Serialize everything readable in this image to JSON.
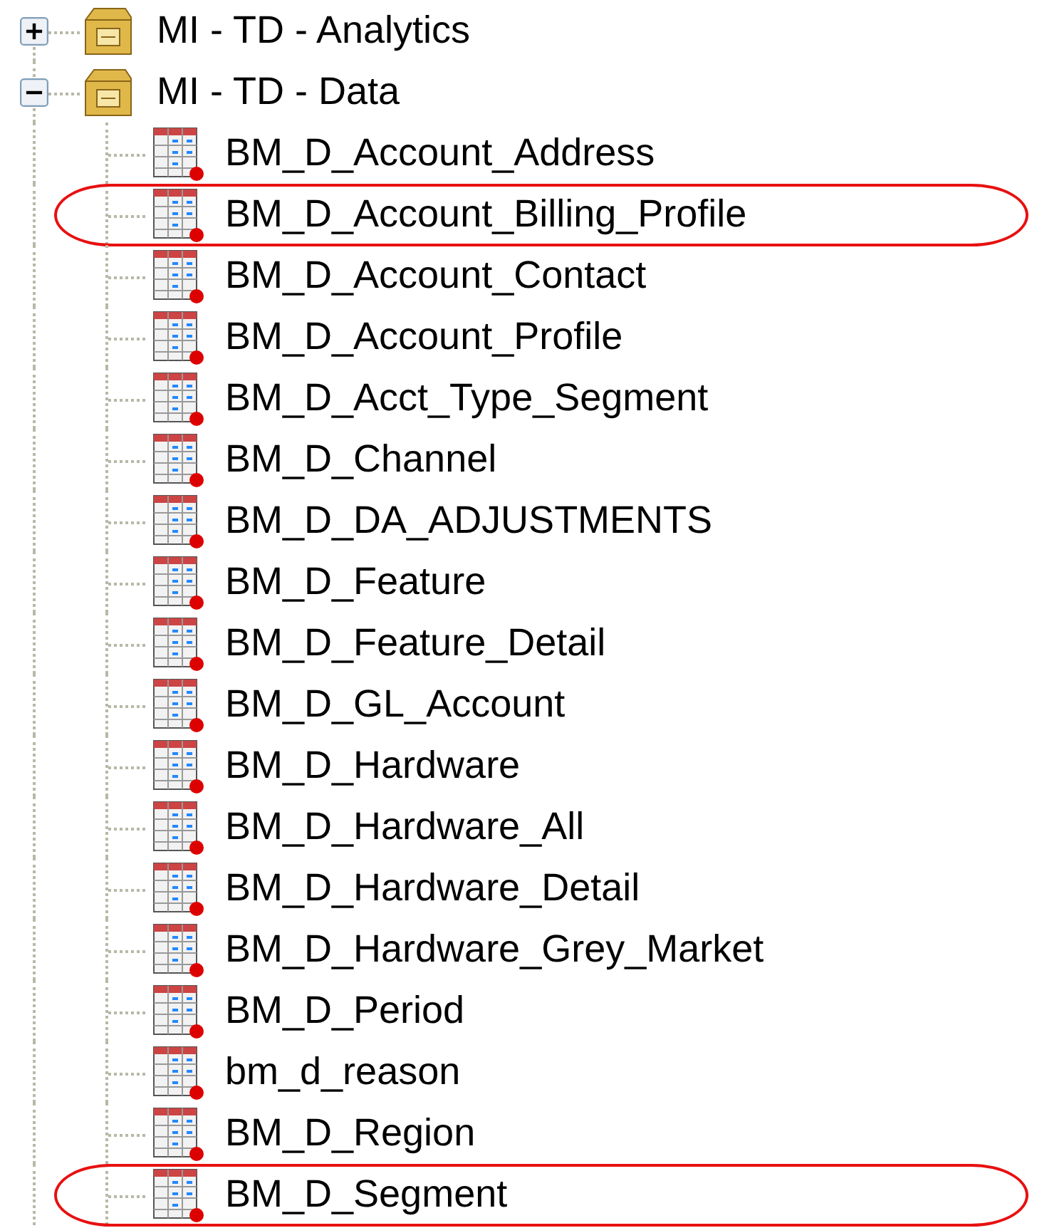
{
  "tree": [
    {
      "label": "MI - TD - Analytics",
      "expanded": false
    },
    {
      "label": "MI - TD - Data",
      "expanded": true,
      "children": [
        {
          "label": "BM_D_Account_Address",
          "circled": false
        },
        {
          "label": "BM_D_Account_Billing_Profile",
          "circled": true
        },
        {
          "label": "BM_D_Account_Contact",
          "circled": false
        },
        {
          "label": "BM_D_Account_Profile",
          "circled": false
        },
        {
          "label": "BM_D_Acct_Type_Segment",
          "circled": false
        },
        {
          "label": "BM_D_Channel",
          "circled": false
        },
        {
          "label": "BM_D_DA_ADJUSTMENTS",
          "circled": false
        },
        {
          "label": "BM_D_Feature",
          "circled": false
        },
        {
          "label": "BM_D_Feature_Detail",
          "circled": false
        },
        {
          "label": "BM_D_GL_Account",
          "circled": false
        },
        {
          "label": "BM_D_Hardware",
          "circled": false
        },
        {
          "label": "BM_D_Hardware_All",
          "circled": false
        },
        {
          "label": "BM_D_Hardware_Detail",
          "circled": false
        },
        {
          "label": "BM_D_Hardware_Grey_Market",
          "circled": false
        },
        {
          "label": "BM_D_Period",
          "circled": false
        },
        {
          "label": "bm_d_reason",
          "circled": false
        },
        {
          "label": "BM_D_Region",
          "circled": false
        },
        {
          "label": "BM_D_Segment",
          "circled": true
        }
      ]
    }
  ]
}
